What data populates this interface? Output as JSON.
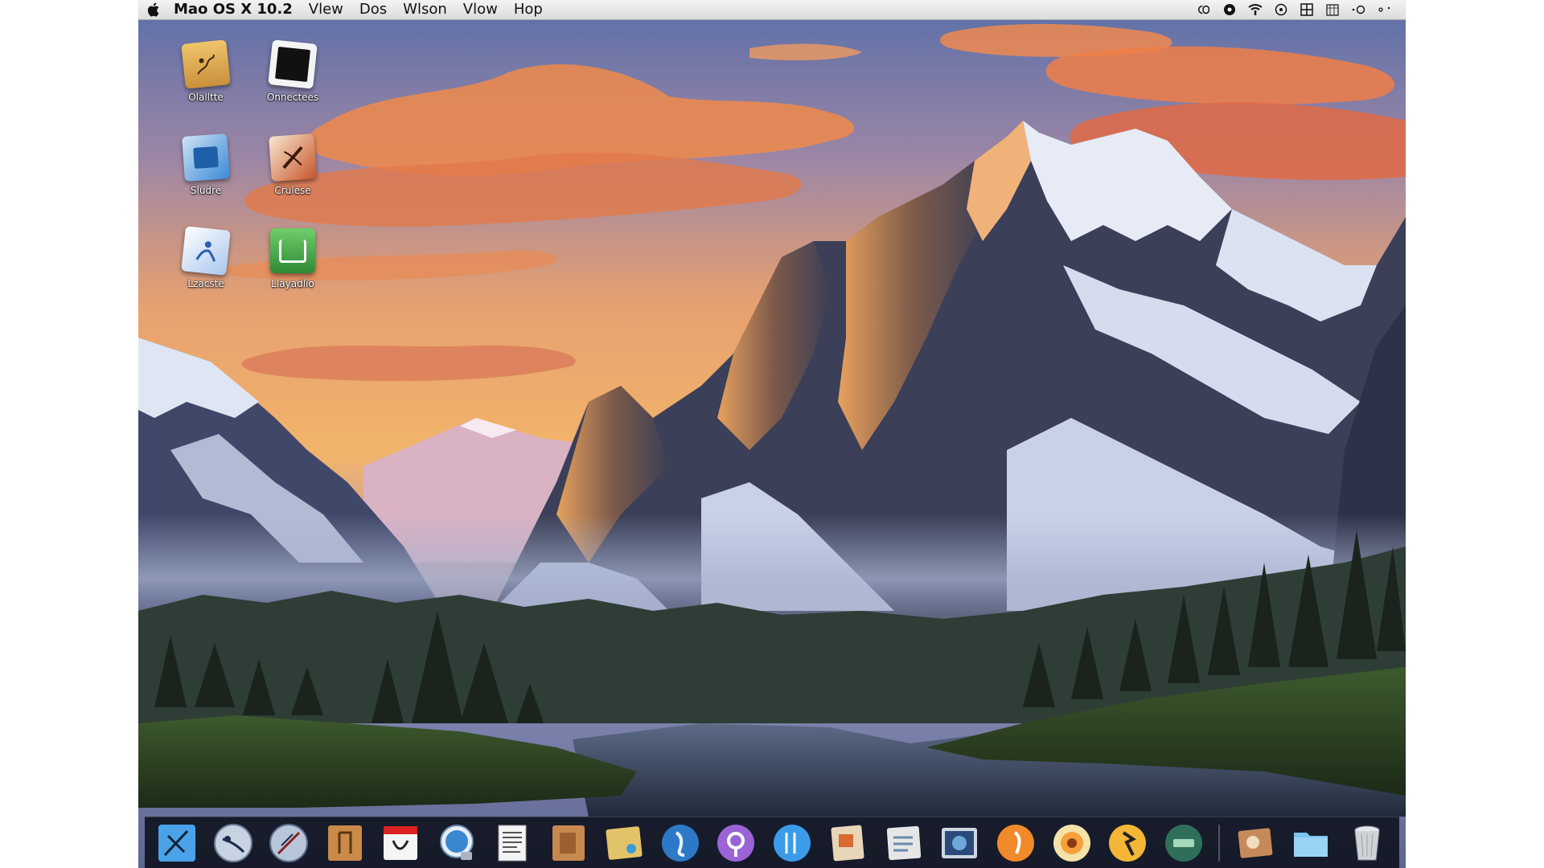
{
  "menubar": {
    "items": [
      "Mao OS X 10.2",
      "Vlew",
      "Dos",
      "Wlson",
      "Vlow",
      "Hop"
    ]
  },
  "status_icons": [
    "display-icon",
    "record-icon",
    "wifi-icon",
    "clock-icon",
    "grid-icon",
    "calendar-icon",
    "spotlight-icon",
    "user-icon"
  ],
  "desktop_icons": [
    {
      "label": "Olalltte",
      "icon": "document-icon",
      "color": "#e8b557"
    },
    {
      "label": "Onnectees",
      "icon": "photo-icon",
      "color": "#f2f2f2"
    },
    {
      "label": "Sludre",
      "icon": "folder-blue-icon",
      "color": "#2f7fd2"
    },
    {
      "label": "Crulese",
      "icon": "brush-icon",
      "color": "#c8552a"
    },
    {
      "label": "Lzacste",
      "icon": "user-book-icon",
      "color": "#5b8fd8"
    },
    {
      "label": "Llayadlio",
      "icon": "green-app-icon",
      "color": "#3fa84a"
    }
  ],
  "dock": {
    "items": [
      {
        "name": "finder-icon",
        "color": "#4aa3e8"
      },
      {
        "name": "safari-icon",
        "color": "#9fb3cc"
      },
      {
        "name": "compass-icon",
        "color": "#a8bcd6"
      },
      {
        "name": "book-icon",
        "color": "#c98a4a"
      },
      {
        "name": "calendar-icon",
        "color": "#f5f5f5"
      },
      {
        "name": "mail-icon",
        "color": "#3a87d0"
      },
      {
        "name": "textedit-icon",
        "color": "#ededed"
      },
      {
        "name": "notebook-icon",
        "color": "#c7894f"
      },
      {
        "name": "photo-icon",
        "color": "#e3c36a"
      },
      {
        "name": "globe-icon",
        "color": "#2e78c8"
      },
      {
        "name": "itunes-icon",
        "color": "#9b63d6"
      },
      {
        "name": "appstore-icon",
        "color": "#3a9ce8"
      },
      {
        "name": "pages-icon",
        "color": "#e09a4c"
      },
      {
        "name": "preview-icon",
        "color": "#e6e6e6"
      },
      {
        "name": "quicktime-icon",
        "color": "#2a4b7a"
      },
      {
        "name": "firefox-icon",
        "color": "#f08a2a"
      },
      {
        "name": "sunflower-icon",
        "color": "#f5a03a"
      },
      {
        "name": "garageband-icon",
        "color": "#f4b637"
      },
      {
        "name": "dashboard-icon",
        "color": "#2f6f5a"
      },
      {
        "name": "iphoto-icon",
        "color": "#c68a5a"
      },
      {
        "name": "documents-folder-icon",
        "color": "#7cc3ef"
      },
      {
        "name": "trash-icon",
        "color": "#cfd3d8"
      }
    ]
  }
}
